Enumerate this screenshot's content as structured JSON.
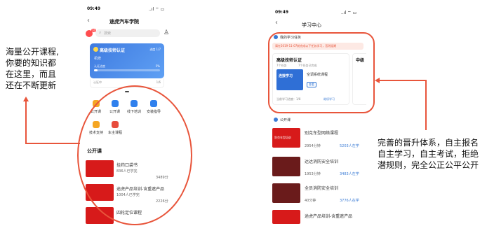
{
  "left_annotation": {
    "lines": [
      "海量公开课程,",
      "你要的知识都",
      "在这里，而且",
      "还在不断更新"
    ]
  },
  "right_annotation": {
    "lines": [
      "完善的晋升体系，自主报名",
      "自主学习，自主考试，拒绝",
      "潜规则，完全公正公平公开"
    ]
  },
  "phone1": {
    "time": "09:49",
    "signal": "..ıl ⌔ ▭",
    "title": "途虎汽车学院",
    "search_placeholder": "搜索",
    "notif_badge": "10",
    "card": {
      "title": "高级技师认证",
      "status": "进度 1/7",
      "subtitle": "机修",
      "progress_label": "认证进度",
      "progress_text": "5%",
      "progress": 0.05,
      "footer_left": "认证中",
      "footer_right": "1/6"
    },
    "shortcuts": [
      {
        "label": "公开课",
        "icon": "public-course-icon",
        "color": "#f5a623"
      },
      {
        "label": "公开课",
        "icon": "course-list-icon",
        "color": "#2f80ed"
      },
      {
        "label": "线下培训",
        "icon": "offline-training-icon",
        "color": "#2f80ed"
      },
      {
        "label": "安装指导",
        "icon": "install-guide-icon",
        "color": "#2f80ed"
      },
      {
        "label": "技术支持",
        "icon": "tech-support-icon",
        "color": "#f5a623"
      },
      {
        "label": "车主课程",
        "icon": "owner-course-icon",
        "color": "#e74c3c"
      }
    ],
    "section_title": "公开课",
    "courses": [
      {
        "title": "挂药口袋书",
        "meta": "836人已学完",
        "right": "3489分"
      },
      {
        "title": "途虎产品培训-含重遮产品",
        "meta": "1004人已学完",
        "right": "2226分"
      },
      {
        "title": "四轮定位课程",
        "meta": "",
        "right": ""
      }
    ]
  },
  "phone2": {
    "time": "09:49",
    "signal": "..ıl ⌔ ▭",
    "title": "学习中心",
    "task_header": "我的学习任务",
    "notice": "请在2019-11-07前完成以下任务学习，否则延期",
    "task_card": {
      "title": "高级技师认证",
      "meta1": "7个任务",
      "meta2": "7个任务已完成",
      "course_name": "空调系统课程",
      "thumb_text": "连接学习",
      "tag": "查看",
      "progress_label": "当前学习进度：1/8",
      "action": "继续学习",
      "side_title": "中级"
    },
    "section_title": "公开课",
    "courses": [
      {
        "title": "别克车型网络课程",
        "left": "2954分钟",
        "right": "5203人在学",
        "thumb_text": "别克车型培训"
      },
      {
        "title": "达达消防安全培训",
        "left": "1953分钟",
        "right": "3483人在学",
        "thumb_text": ""
      },
      {
        "title": "全员消防安全培训",
        "left": "40分钟",
        "right": "3776人在学",
        "thumb_text": ""
      },
      {
        "title": "途虎产品培训-含重遮产品",
        "left": "",
        "right": "",
        "thumb_text": ""
      }
    ]
  }
}
